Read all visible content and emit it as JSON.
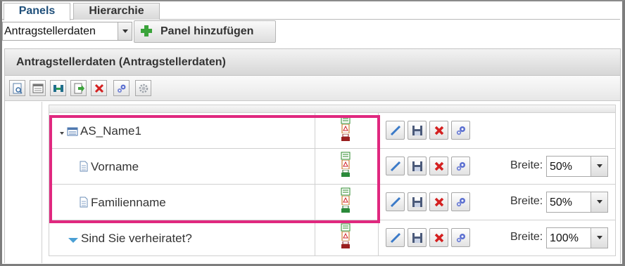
{
  "tabs": [
    {
      "label": "Panels",
      "active": true
    },
    {
      "label": "Hierarchie",
      "active": false
    }
  ],
  "panel_select": {
    "value": "Antragstellerdaten"
  },
  "add_panel_button": {
    "label": "Panel hinzufügen",
    "icon": "plus-icon"
  },
  "panel": {
    "title": "Antragstellerdaten (Antragstellerdaten)",
    "toolbar": [
      {
        "name": "preview",
        "icon": "preview-icon"
      },
      {
        "name": "properties",
        "icon": "window-icon"
      },
      {
        "name": "move",
        "icon": "move-icon"
      },
      {
        "name": "export",
        "icon": "export-icon"
      },
      {
        "name": "delete",
        "icon": "delete-icon"
      },
      {
        "name": "settings",
        "icon": "gears-icon"
      },
      {
        "name": "config",
        "icon": "gear-icon"
      }
    ]
  },
  "rows": [
    {
      "label": "AS_Name1",
      "icon": "group-icon",
      "expander": "collapse-arrow-icon",
      "breite": null
    },
    {
      "label": "Vorname",
      "icon": "document-icon",
      "breite": {
        "label": "Breite:",
        "value": "50%"
      }
    },
    {
      "label": "Familienname",
      "icon": "document-icon",
      "breite": {
        "label": "Breite:",
        "value": "50%"
      }
    },
    {
      "label": "Sind Sie verheiratet?",
      "icon": "dropdown-icon",
      "breite": {
        "label": "Breite:",
        "value": "100%"
      }
    }
  ],
  "colors": {
    "highlight": "#e0287f",
    "tab_active_text": "#1f4f7a"
  }
}
